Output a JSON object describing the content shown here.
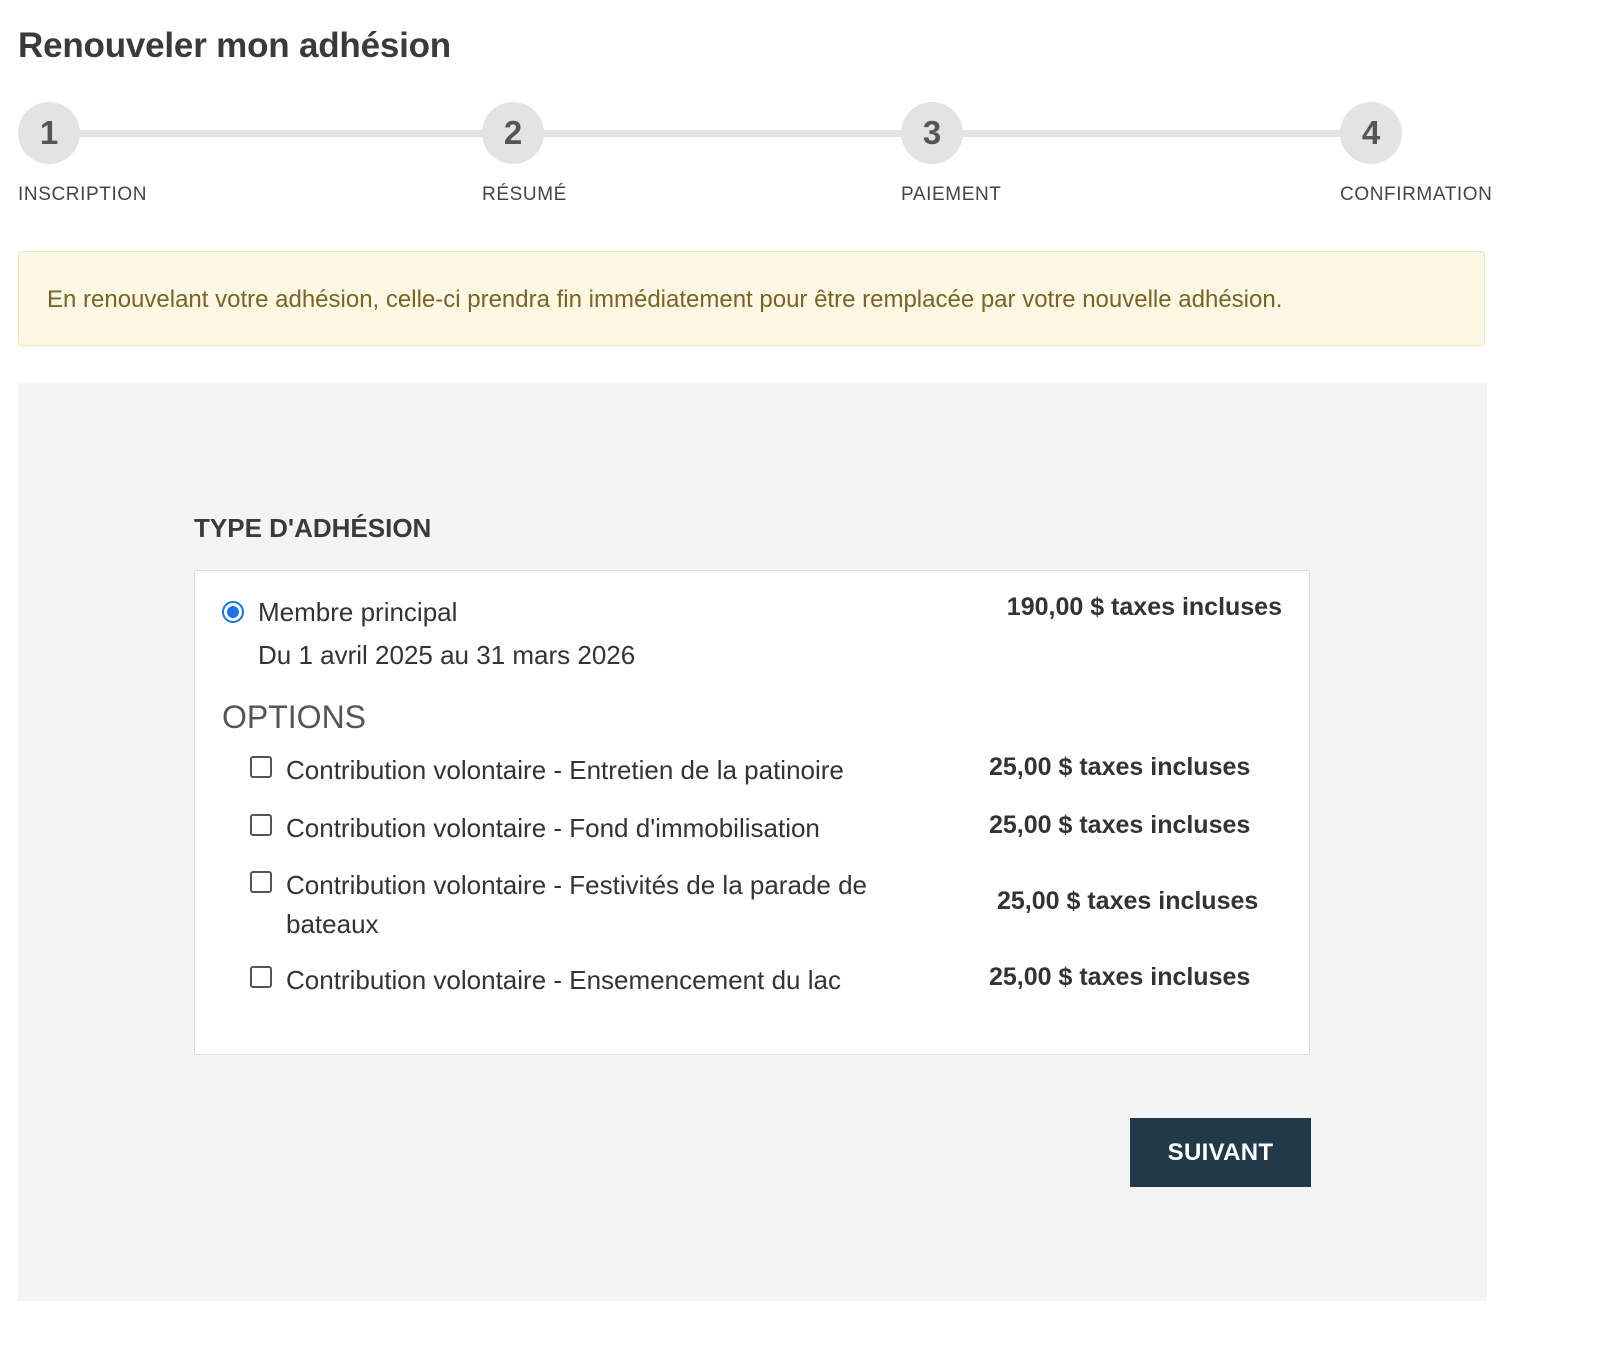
{
  "page": {
    "title": "Renouveler mon adhésion"
  },
  "steps": [
    {
      "number": "1",
      "label": "INSCRIPTION"
    },
    {
      "number": "2",
      "label": "RÉSUMÉ"
    },
    {
      "number": "3",
      "label": "PAIEMENT"
    },
    {
      "number": "4",
      "label": "CONFIRMATION"
    }
  ],
  "notice": {
    "text": "En renouvelant votre adhésion, celle-ci prendra fin immédiatement pour être remplacée par votre nouvelle adhésion."
  },
  "membership_section": {
    "title": "TYPE D'ADHÉSION",
    "membership": {
      "name": "Membre principal",
      "dates": "Du 1 avril 2025 au 31 mars 2026",
      "price": "190,00 $ taxes incluses",
      "selected": true
    },
    "options_title": "OPTIONS",
    "options": [
      {
        "label": "Contribution volontaire - Entretien de la patinoire",
        "price": "25,00 $ taxes incluses",
        "checked": false
      },
      {
        "label": "Contribution volontaire - Fond d'immobilisation",
        "price": "25,00 $ taxes incluses",
        "checked": false
      },
      {
        "label": "Contribution volontaire - Festivités de la parade de bateaux",
        "price": "25,00 $ taxes incluses",
        "checked": false
      },
      {
        "label": "Contribution volontaire - Ensemencement du lac",
        "price": "25,00 $ taxes incluses",
        "checked": false
      }
    ]
  },
  "actions": {
    "next_label": "SUIVANT"
  },
  "colors": {
    "primary_button": "#22394a",
    "radio_accent": "#1a73e8",
    "notice_background": "#fdf7e3",
    "notice_text": "#7a6325",
    "step_circle": "#e3e3e3",
    "panel_background": "#f4f4f4"
  }
}
